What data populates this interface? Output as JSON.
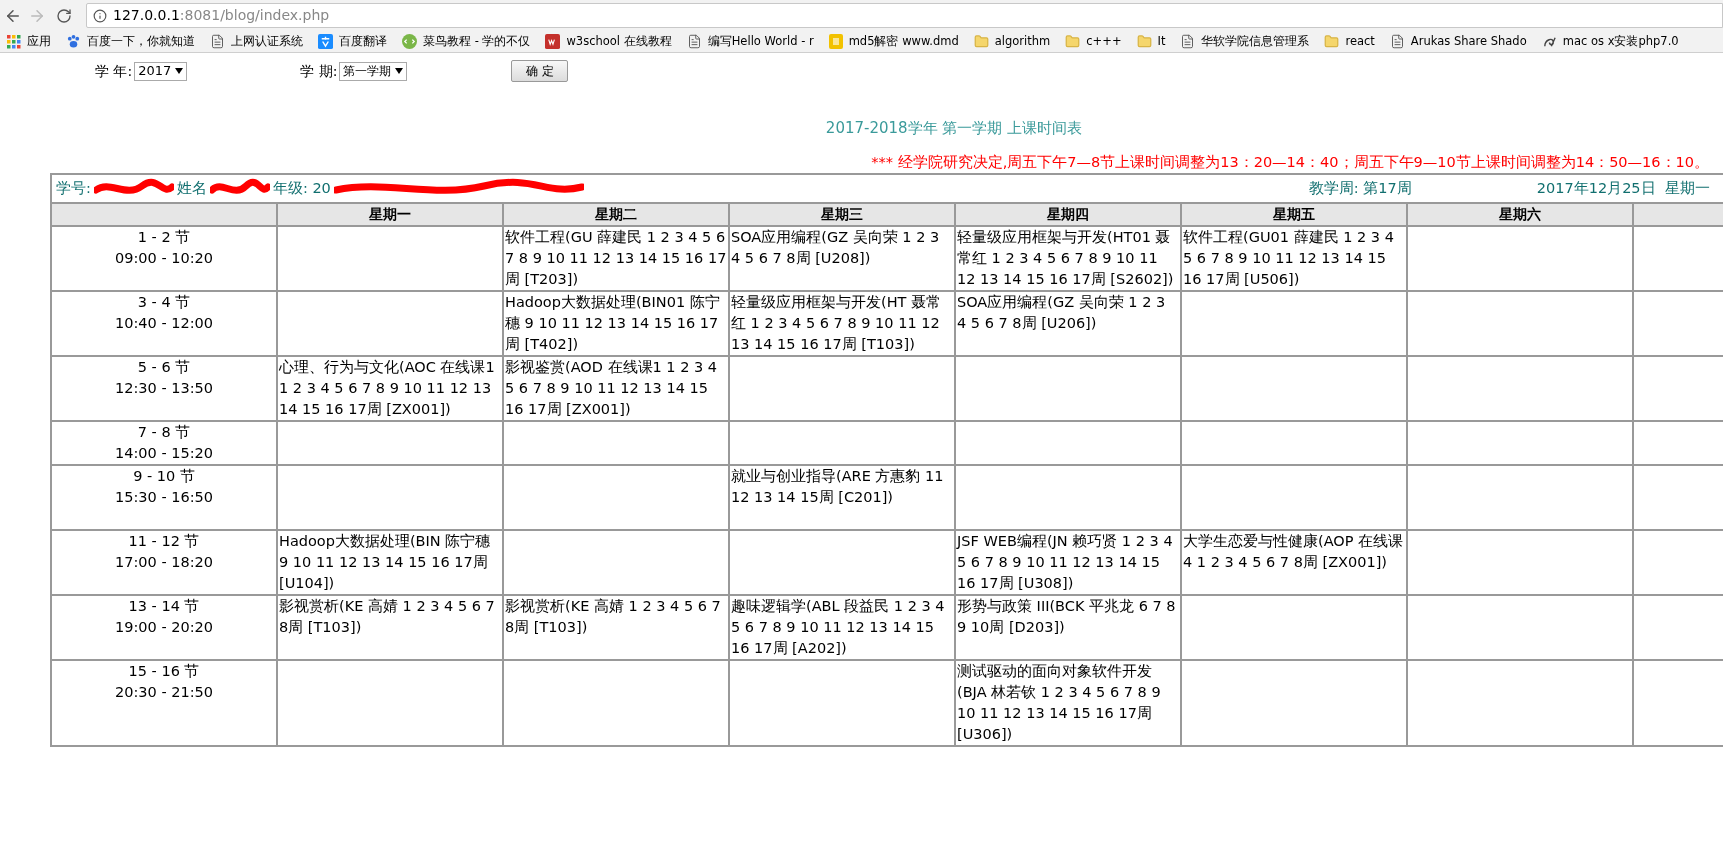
{
  "browser": {
    "url_host": "127.0.0.1",
    "url_rest": ":8081/blog/index.php",
    "bookmarks": [
      {
        "label": "应用",
        "kind": "apps"
      },
      {
        "label": "百度一下，你就知道",
        "kind": "paw"
      },
      {
        "label": "上网认证系统",
        "kind": "page"
      },
      {
        "label": "百度翻译",
        "kind": "translate"
      },
      {
        "label": "菜鸟教程 - 学的不仅",
        "kind": "runoob"
      },
      {
        "label": "w3school 在线教程",
        "kind": "w3"
      },
      {
        "label": "编写Hello World - r",
        "kind": "page"
      },
      {
        "label": "md5解密 www.dmd",
        "kind": "letter"
      },
      {
        "label": "algorithm",
        "kind": "folder"
      },
      {
        "label": "c+++",
        "kind": "folder"
      },
      {
        "label": "It",
        "kind": "folder"
      },
      {
        "label": "华软学院信息管理系",
        "kind": "page"
      },
      {
        "label": "react",
        "kind": "folder"
      },
      {
        "label": "Arukas Share Shado",
        "kind": "page"
      },
      {
        "label": "mac os x安装php7.0",
        "kind": "swirl"
      }
    ]
  },
  "form": {
    "year_label": "学 年:",
    "year_value": "2017",
    "term_label": "学 期:",
    "term_value": "第一学期",
    "submit": "确 定"
  },
  "title": "2017-2018学年 第一学期 上课时间表",
  "notice": "*** 经学院研究决定,周五下午7—8节上课时间调整为13：20—14：40；周五下午9—10节上课时间调整为14：50—16：10。",
  "info": {
    "fields": [
      "学号:",
      "姓名",
      "年级: 20"
    ],
    "week": "教学周: 第17周",
    "date": "2017年12月25日  星期一"
  },
  "table": {
    "columns": [
      "星期一",
      "星期二",
      "星期三",
      "星期四",
      "星期五",
      "星期六"
    ],
    "rows": [
      {
        "period": "1 - 2 节",
        "time": "09:00 - 10:20",
        "cells": [
          null,
          "软件工程(GU 薛建民 1 2 3 4 5 6 7 8 9 10 11 12 13 14 15 16 17周 [T203])",
          "SOA应用编程(GZ 吴向荣 1 2 3 4 5 6 7 8周 [U208])",
          "轻量级应用框架与开发(HT01 聂常红 1 2 3 4 5 6 7 8 9 10 11 12 13 14 15 16 17周 [S2602])",
          "软件工程(GU01 薛建民 1 2 3 4 5 6 7 8 9 10 11 12 13 14 15 16 17周 [U506])",
          null
        ]
      },
      {
        "period": "3 - 4 节",
        "time": "10:40 - 12:00",
        "cells": [
          null,
          "Hadoop大数据处理(BIN01 陈宁穗 9 10 11 12 13 14 15 16 17周 [T402])",
          "轻量级应用框架与开发(HT 聂常红 1 2 3 4 5 6 7 8 9 10 11 12 13 14 15 16 17周 [T103])",
          "SOA应用编程(GZ 吴向荣 1 2 3 4 5 6 7 8周 [U206])",
          null,
          null
        ]
      },
      {
        "period": "5 - 6 节",
        "time": "12:30 - 13:50",
        "cells": [
          "心理、行为与文化(AOC 在线课1 1 2 3 4 5 6 7 8 9 10 11 12 13 14 15 16 17周 [ZX001])",
          "影视鉴赏(AOD 在线课1 1 2 3 4 5 6 7 8 9 10 11 12 13 14 15 16 17周 [ZX001])",
          null,
          null,
          null,
          null
        ]
      },
      {
        "period": "7 - 8 节",
        "time": "14:00 - 15:20",
        "cells": [
          null,
          null,
          null,
          null,
          null,
          null
        ]
      },
      {
        "period": "9 - 10 节",
        "time": "15:30 - 16:50",
        "cells": [
          null,
          null,
          "就业与创业指导(ARE 方惠豹 11 12 13 14 15周 [C201])",
          null,
          null,
          null
        ]
      },
      {
        "period": "11 - 12 节",
        "time": "17:00 - 18:20",
        "cells": [
          "Hadoop大数据处理(BIN 陈宁穗 9 10 11 12 13 14 15 16 17周 [U104])",
          null,
          null,
          "JSF WEB编程(JN 赖巧贤 1 2 3 4 5 6 7 8 9 10 11 12 13 14 15 16 17周 [U308])",
          "大学生恋爱与性健康(AOP 在线课4 1 2 3 4 5 6 7 8周 [ZX001])",
          null
        ]
      },
      {
        "period": "13 - 14 节",
        "time": "19:00 - 20:20",
        "cells": [
          "影视赏析(KE 高婧 1 2 3 4 5 6 7 8周 [T103])",
          "影视赏析(KE 高婧 1 2 3 4 5 6 7 8周 [T103])",
          "趣味逻辑学(ABL 段益民 1 2 3 4 5 6 7 8 9 10 11 12 13 14 15 16 17周 [A202])",
          "形势与政策 III(BCK 平兆龙 6 7 8 9 10周 [D203])",
          null,
          null
        ]
      },
      {
        "period": "15 - 16 节",
        "time": "20:30 - 21:50",
        "cells": [
          null,
          null,
          null,
          "测试驱动的面向对象软件开发(BJA 林若钦 1 2 3 4 5 6 7 8 9 10 11 12 13 14 15 16 17周 [U306])",
          null,
          null
        ]
      }
    ]
  }
}
